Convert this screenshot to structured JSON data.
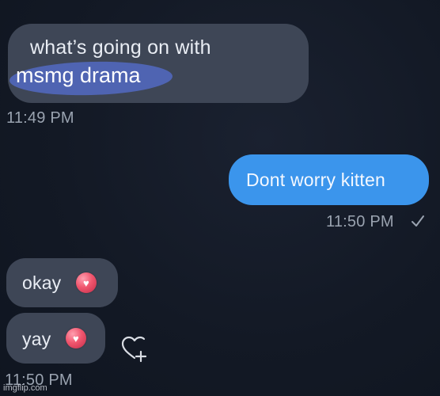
{
  "messages": [
    {
      "direction": "incoming",
      "line1": "what’s going on with",
      "highlighted_text": "msmg drama",
      "timestamp": "11:49 PM"
    },
    {
      "direction": "outgoing",
      "text": "Dont worry kitten",
      "timestamp": "11:50 PM",
      "status_icon": "checkmark-icon"
    },
    {
      "direction": "incoming",
      "text": "okay",
      "emoji": "heart-icon"
    },
    {
      "direction": "incoming",
      "text": "yay",
      "emoji": "heart-icon",
      "reaction_icon": "add-reaction-heart-icon",
      "timestamp": "11:50 PM"
    }
  ],
  "watermark": "imgflip.com",
  "colors": {
    "background": "#141a26",
    "incoming_bubble": "#3e4656",
    "outgoing_bubble": "#3b95ec",
    "highlight": "#4f64b2",
    "timestamp": "#9aa3b0"
  }
}
